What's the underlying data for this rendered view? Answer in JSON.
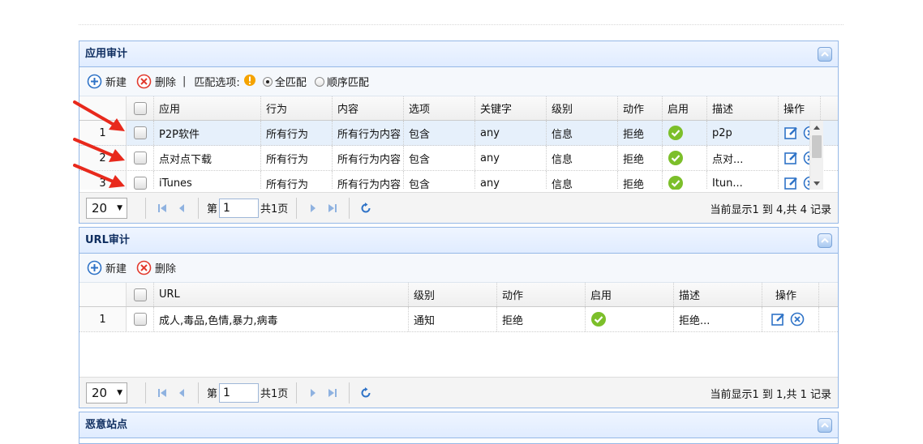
{
  "colors": {
    "header_border": "#95b8e7",
    "arrow_red": "#e8291c",
    "ok_green": "#7cbf2a",
    "icon_blue": "#2f73c7"
  },
  "app_audit": {
    "title": "应用审计",
    "toolbar": {
      "new_label": "新建",
      "delete_label": "删除",
      "separator": "|",
      "match_label": "匹配选项:",
      "radio_all_label": "全匹配",
      "radio_order_label": "顺序匹配",
      "selected_radio": "全匹配"
    },
    "columns": [
      "应用",
      "行为",
      "内容",
      "选项",
      "关键字",
      "级别",
      "动作",
      "启用",
      "描述",
      "操作"
    ],
    "rows": [
      {
        "num": "1",
        "app": "P2P软件",
        "behavior": "所有行为",
        "content": "所有行为内容",
        "option": "包含",
        "keyword": "any",
        "level": "信息",
        "action": "拒绝",
        "enabled": true,
        "desc": "p2p"
      },
      {
        "num": "2",
        "app": "点对点下载",
        "behavior": "所有行为",
        "content": "所有行为内容",
        "option": "包含",
        "keyword": "any",
        "level": "信息",
        "action": "拒绝",
        "enabled": true,
        "desc": "点对..."
      },
      {
        "num": "3",
        "app": "iTunes",
        "behavior": "所有行为",
        "content": "所有行为内容",
        "option": "包含",
        "keyword": "any",
        "level": "信息",
        "action": "拒绝",
        "enabled": true,
        "desc": "Itun..."
      }
    ],
    "pager": {
      "page_size": "20",
      "page_prefix": "第",
      "page_value": "1",
      "total_pages": "共1页",
      "info": "当前显示1 到 4,共 4 记录"
    }
  },
  "url_audit": {
    "title": "URL审计",
    "toolbar": {
      "new_label": "新建",
      "delete_label": "删除"
    },
    "columns": [
      "URL",
      "级别",
      "动作",
      "启用",
      "描述",
      "操作"
    ],
    "rows": [
      {
        "num": "1",
        "url": "成人,毒品,色情,暴力,病毒",
        "level": "通知",
        "action": "拒绝",
        "enabled": true,
        "desc": "拒绝..."
      }
    ],
    "pager": {
      "page_size": "20",
      "page_prefix": "第",
      "page_value": "1",
      "total_pages": "共1页",
      "info": "当前显示1 到 1,共 1 记录"
    }
  },
  "malicious_sites": {
    "title": "恶意站点"
  }
}
